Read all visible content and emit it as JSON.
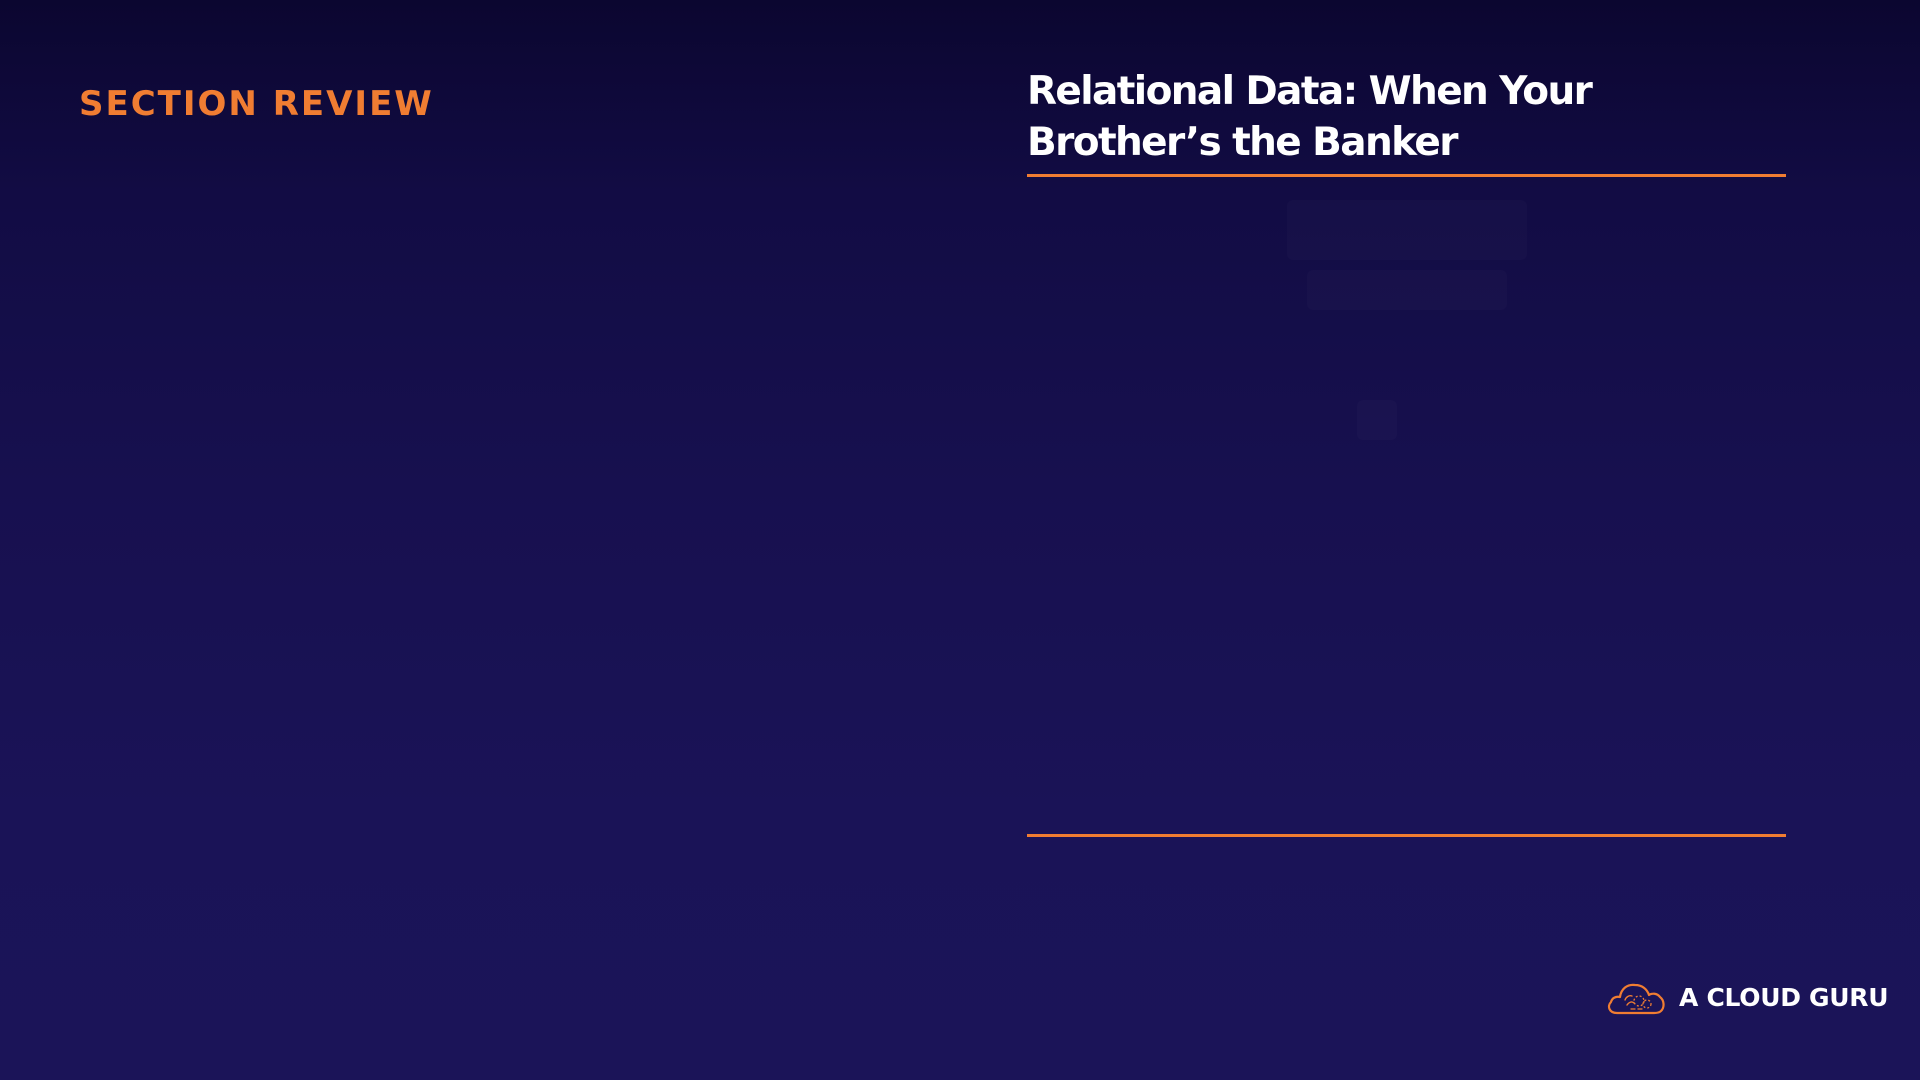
{
  "slide": {
    "section_label": "SECTION REVIEW",
    "title_line1": "Relational Data: When Your",
    "title_line2": "Brother’s the Banker"
  },
  "brand": {
    "name": "A CLOUD GURU",
    "icon": "cloud-guru-logo-icon",
    "accent_color": "#f07d32"
  },
  "colors": {
    "background_top": "#0b0630",
    "background_bottom": "#1b1458",
    "accent": "#f07d32",
    "title": "#ffffff"
  }
}
